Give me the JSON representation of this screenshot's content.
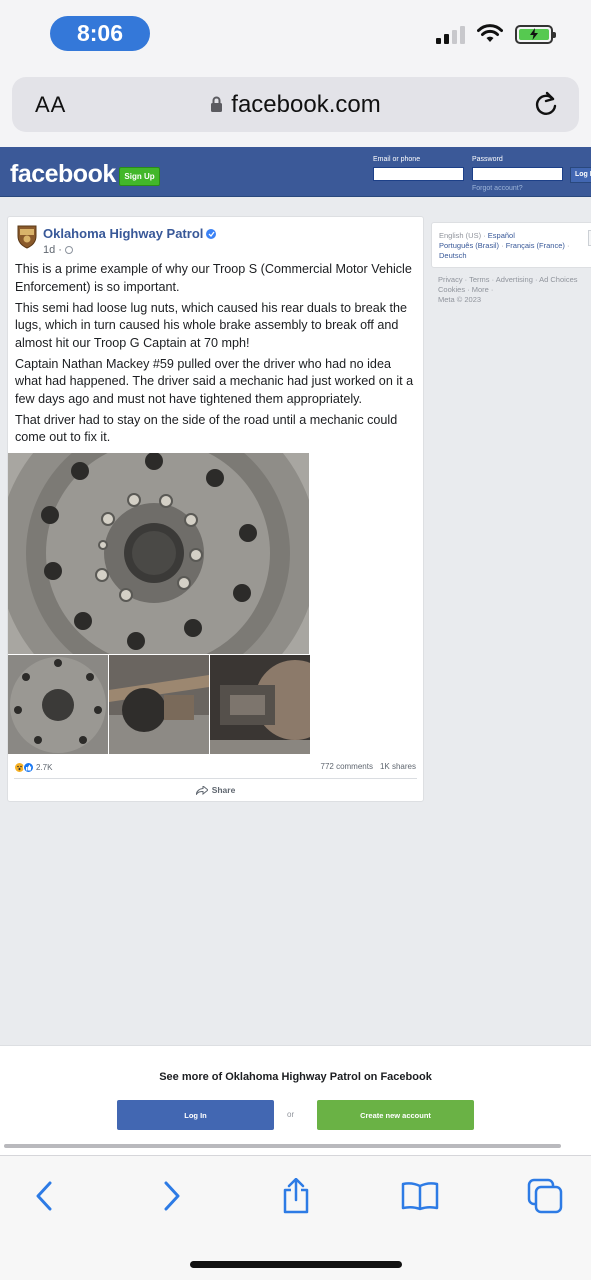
{
  "status_bar": {
    "time": "8:06"
  },
  "browser": {
    "text_size_label": "AA",
    "url": "facebook.com"
  },
  "fb_header": {
    "logo": "facebook",
    "signup": "Sign Up",
    "email_label": "Email or phone",
    "password_label": "Password",
    "forgot": "Forgot account?",
    "login": "Log In"
  },
  "post": {
    "page_name": "Oklahoma Highway Patrol",
    "time": "1d",
    "paragraphs": [
      "This is a prime example of why our Troop S (Commercial Motor Vehicle Enforcement) is so important.",
      "This semi had loose lug nuts, which caused his rear duals to break the lugs, which in turn caused his whole brake assembly to break off and almost hit our Troop G Captain at 70 mph!",
      "Captain Nathan Mackey #59 pulled over the driver who had no idea what had happened. The driver said a mechanic had just worked on it a few days ago and must not have tightened them appropriately.",
      "That driver had to stay on the side of the road until a mechanic could come out to fix it."
    ],
    "reaction_count": "2.7K",
    "comments": "772 comments",
    "shares": "1K shares",
    "share_label": "Share"
  },
  "sidebar": {
    "current_language": "English (US)",
    "languages": [
      "Español",
      "Português (Brasil)",
      "Français (France)",
      "Deutsch"
    ],
    "footer_line1": "Privacy · Terms · Advertising · Ad Choices",
    "footer_line2": "Cookies · More ·",
    "footer_line3": "Meta © 2023"
  },
  "login_prompt": {
    "title": "See more of Oklahoma Highway Patrol on Facebook",
    "login": "Log In",
    "or": "or",
    "create": "Create new account"
  },
  "colors": {
    "fb_blue": "#3b5998",
    "fb_green": "#42b72a",
    "ios_blue": "#3478d9",
    "battery_green": "#56c950"
  }
}
